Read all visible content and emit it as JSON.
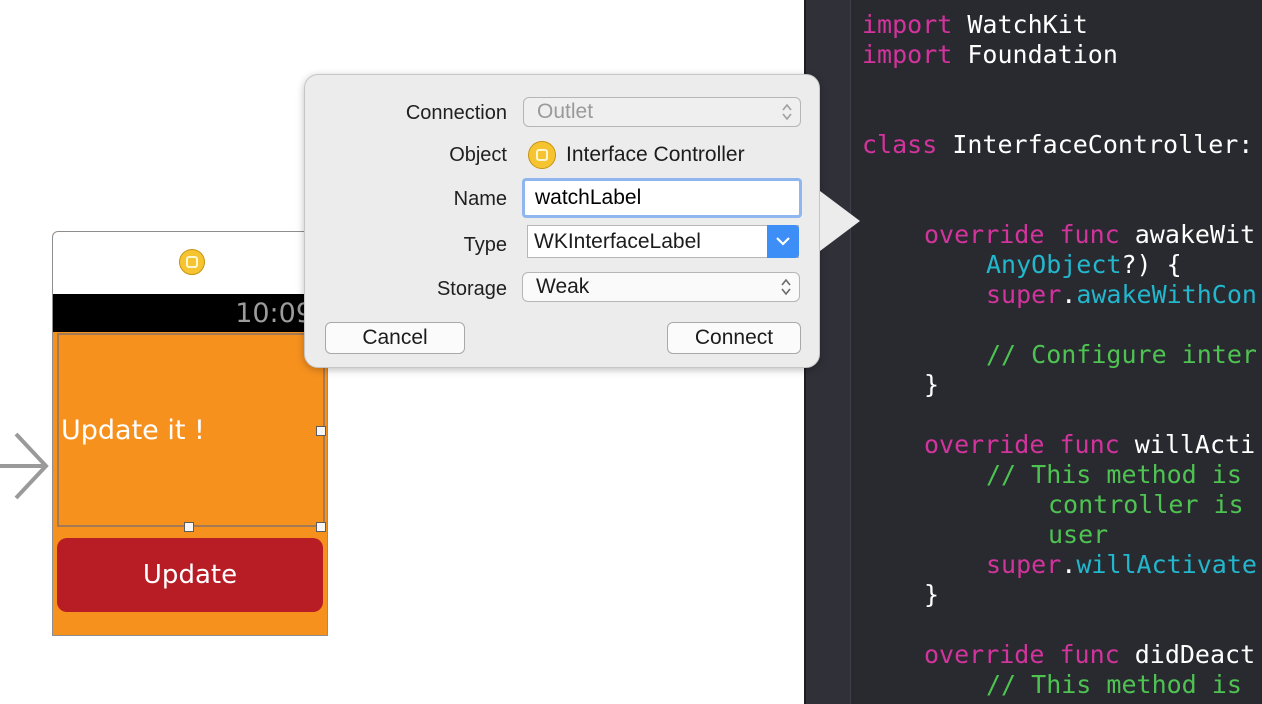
{
  "storyboard": {
    "status_time": "10:09",
    "label_text": "Update it !",
    "button_label": "Update"
  },
  "popover": {
    "connection": {
      "label": "Connection",
      "value": "Outlet"
    },
    "object": {
      "label": "Object",
      "value": "Interface Controller"
    },
    "name": {
      "label": "Name",
      "value": "watchLabel"
    },
    "type": {
      "label": "Type",
      "value": "WKInterfaceLabel"
    },
    "storage": {
      "label": "Storage",
      "value": "Weak"
    },
    "cancel_label": "Cancel",
    "connect_label": "Connect"
  },
  "code": {
    "l1_kw": "import",
    "l1_rest": " WatchKit",
    "l2_kw": "import",
    "l2_rest": " Foundation",
    "l3_kw": "class",
    "l3_rest": " InterfaceController:",
    "l4_kw": "override func",
    "l4_rest": " awakeWit",
    "l5_ty": "AnyObject",
    "l5_rest": "?) {",
    "l6_kw": "super",
    "l6_dot": ".",
    "l6_ty": "awakeWithCon",
    "l7_cm": "// Configure inter",
    "l8": "}",
    "l9_kw": "override func",
    "l9_rest": " willActi",
    "l10_cm": "// This method is",
    "l11_cm": "controller is",
    "l12_cm": "user",
    "l13_kw": "super",
    "l13_dot": ".",
    "l13_ty": "willActivate",
    "l14": "}",
    "l15_kw": "override func",
    "l15_rest": " didDeact",
    "l16_cm": "// This method is"
  },
  "colors": {
    "watch_background": "#f7911e",
    "button_red": "#b81d25",
    "editor_background": "#292a30",
    "keyword": "#d3339c",
    "type": "#22b7cd",
    "comment": "#4ec352",
    "accent_blue": "#3e8ef7"
  }
}
